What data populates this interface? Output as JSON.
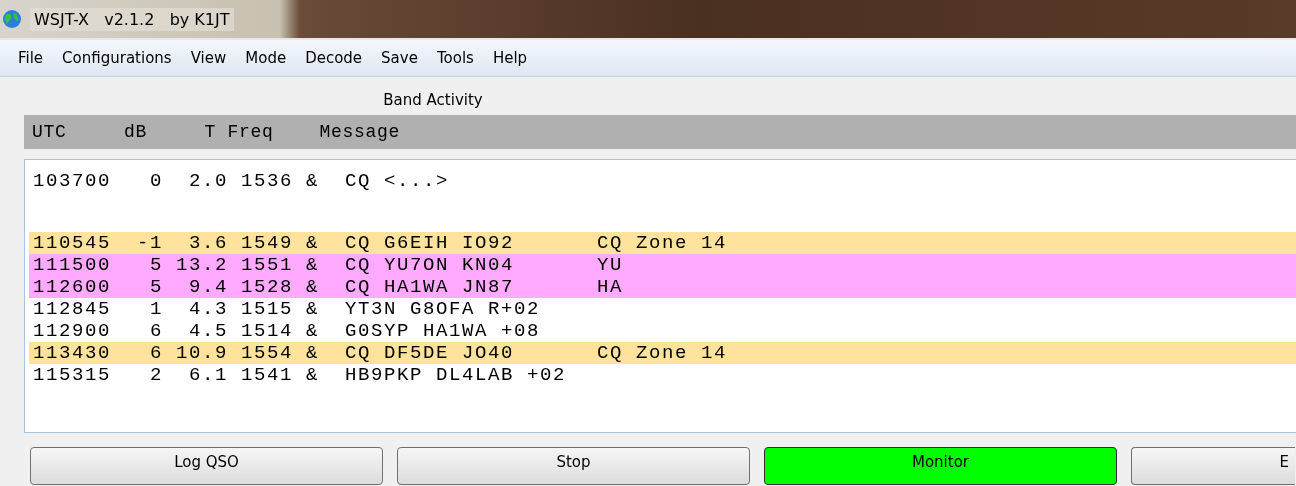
{
  "window": {
    "title": "WSJT-X   v2.1.2   by K1JT"
  },
  "menu": [
    "File",
    "Configurations",
    "View",
    "Mode",
    "Decode",
    "Save",
    "Tools",
    "Help"
  ],
  "band_activity": {
    "title": "Band Activity",
    "header": "UTC     dB     T Freq    Message",
    "groups": [
      {
        "rows": [
          {
            "text": "103700   0  2.0 1536 &  CQ <...>",
            "note": "",
            "color": "#ffffff"
          }
        ]
      },
      {
        "rows": [
          {
            "text": "110545  -1  3.6 1549 &  CQ G6EIH IO92",
            "note": "CQ Zone 14",
            "color": "#ffe39c"
          },
          {
            "text": "111500   5 13.2 1551 &  CQ YU7ON KN04",
            "note": "YU",
            "color": "#ffaaff"
          },
          {
            "text": "112600   5  9.4 1528 &  CQ HA1WA JN87",
            "note": "HA",
            "color": "#ffaaff"
          },
          {
            "text": "112845   1  4.3 1515 &  YT3N G8OFA R+02",
            "note": "",
            "color": "#ffffff"
          },
          {
            "text": "112900   6  4.5 1514 &  G0SYP HA1WA +08",
            "note": "",
            "color": "#ffffff"
          },
          {
            "text": "113430   6 10.9 1554 &  CQ DF5DE JO40",
            "note": "CQ Zone 14",
            "color": "#ffe39c"
          },
          {
            "text": "115315   2  6.1 1541 &  HB9PKP DL4LAB +02",
            "note": "",
            "color": "#ffffff"
          }
        ]
      }
    ]
  },
  "buttons": [
    {
      "label": "Log QSO",
      "on": false
    },
    {
      "label": "Stop",
      "on": false
    },
    {
      "label": "Monitor",
      "on": true
    },
    {
      "label": "E",
      "on": false
    }
  ]
}
